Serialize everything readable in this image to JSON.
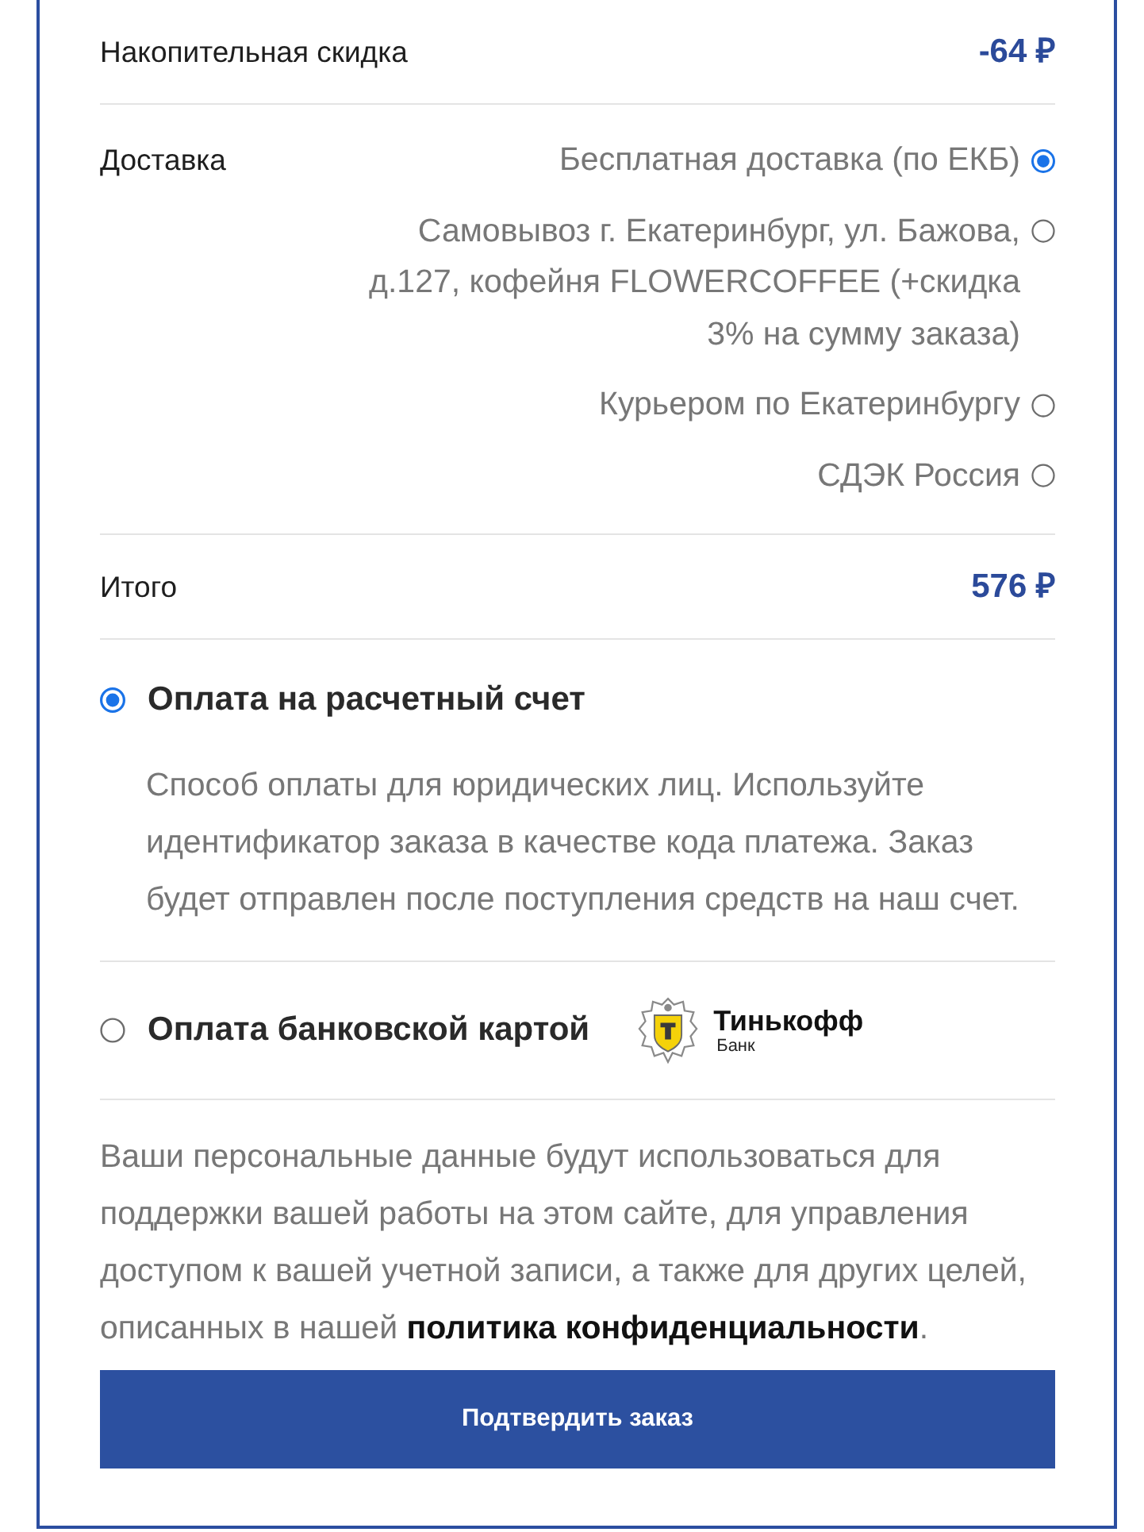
{
  "discount": {
    "label": "Накопительная скидка",
    "value": "-64 ₽"
  },
  "delivery": {
    "label": "Доставка",
    "options": [
      {
        "label": "Бесплатная доставка (по ЕКБ)",
        "selected": true
      },
      {
        "label": "Самовывоз г. Екатеринбург, ул. Бажова, д.127, кофейня FLOWERCOFFEE (+скидка 3% на сумму заказа)",
        "selected": false
      },
      {
        "label": "Курьером по Екатеринбургу",
        "selected": false
      },
      {
        "label": "СДЭК Россия",
        "selected": false
      }
    ]
  },
  "total": {
    "label": "Итого",
    "value": "576 ₽"
  },
  "payment_methods": [
    {
      "kind": "transfer",
      "label": "Оплата на расчетный счет",
      "selected": true,
      "description": "Способ оплаты для юридических лиц. Используйте идентификатор заказа в качестве кода платежа. Заказ будет отправлен после поступления средств на наш счет."
    },
    {
      "kind": "card",
      "label": "Оплата банковской картой",
      "selected": false,
      "logo": {
        "name": "Тинькофф",
        "subtitle": "Банк"
      }
    }
  ],
  "privacy_notice": {
    "text": "Ваши персональные данные будут использоваться для поддержки вашей работы на этом сайте, для управления доступом к вашей учетной записи, а также для других целей, описанных в нашей ",
    "link": "политика конфиденциальности",
    "tail": "."
  },
  "confirm_button": {
    "label": "Подтвердить заказ"
  }
}
